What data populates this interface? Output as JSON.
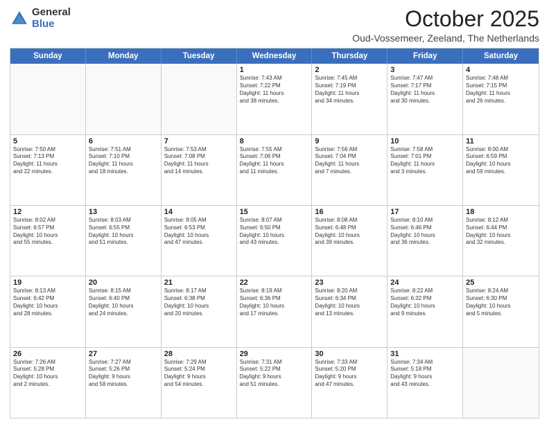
{
  "header": {
    "logo_general": "General",
    "logo_blue": "Blue",
    "month": "October 2025",
    "location": "Oud-Vossemeer, Zeeland, The Netherlands"
  },
  "days_of_week": [
    "Sunday",
    "Monday",
    "Tuesday",
    "Wednesday",
    "Thursday",
    "Friday",
    "Saturday"
  ],
  "weeks": [
    [
      {
        "day": "",
        "text": ""
      },
      {
        "day": "",
        "text": ""
      },
      {
        "day": "",
        "text": ""
      },
      {
        "day": "1",
        "text": "Sunrise: 7:43 AM\nSunset: 7:22 PM\nDaylight: 11 hours\nand 38 minutes."
      },
      {
        "day": "2",
        "text": "Sunrise: 7:45 AM\nSunset: 7:19 PM\nDaylight: 11 hours\nand 34 minutes."
      },
      {
        "day": "3",
        "text": "Sunrise: 7:47 AM\nSunset: 7:17 PM\nDaylight: 11 hours\nand 30 minutes."
      },
      {
        "day": "4",
        "text": "Sunrise: 7:48 AM\nSunset: 7:15 PM\nDaylight: 11 hours\nand 26 minutes."
      }
    ],
    [
      {
        "day": "5",
        "text": "Sunrise: 7:50 AM\nSunset: 7:13 PM\nDaylight: 11 hours\nand 22 minutes."
      },
      {
        "day": "6",
        "text": "Sunrise: 7:51 AM\nSunset: 7:10 PM\nDaylight: 11 hours\nand 18 minutes."
      },
      {
        "day": "7",
        "text": "Sunrise: 7:53 AM\nSunset: 7:08 PM\nDaylight: 11 hours\nand 14 minutes."
      },
      {
        "day": "8",
        "text": "Sunrise: 7:55 AM\nSunset: 7:06 PM\nDaylight: 11 hours\nand 11 minutes."
      },
      {
        "day": "9",
        "text": "Sunrise: 7:56 AM\nSunset: 7:04 PM\nDaylight: 11 hours\nand 7 minutes."
      },
      {
        "day": "10",
        "text": "Sunrise: 7:58 AM\nSunset: 7:01 PM\nDaylight: 11 hours\nand 3 minutes."
      },
      {
        "day": "11",
        "text": "Sunrise: 8:00 AM\nSunset: 6:59 PM\nDaylight: 10 hours\nand 59 minutes."
      }
    ],
    [
      {
        "day": "12",
        "text": "Sunrise: 8:02 AM\nSunset: 6:57 PM\nDaylight: 10 hours\nand 55 minutes."
      },
      {
        "day": "13",
        "text": "Sunrise: 8:03 AM\nSunset: 6:55 PM\nDaylight: 10 hours\nand 51 minutes."
      },
      {
        "day": "14",
        "text": "Sunrise: 8:05 AM\nSunset: 6:53 PM\nDaylight: 10 hours\nand 47 minutes."
      },
      {
        "day": "15",
        "text": "Sunrise: 8:07 AM\nSunset: 6:50 PM\nDaylight: 10 hours\nand 43 minutes."
      },
      {
        "day": "16",
        "text": "Sunrise: 8:08 AM\nSunset: 6:48 PM\nDaylight: 10 hours\nand 39 minutes."
      },
      {
        "day": "17",
        "text": "Sunrise: 8:10 AM\nSunset: 6:46 PM\nDaylight: 10 hours\nand 36 minutes."
      },
      {
        "day": "18",
        "text": "Sunrise: 8:12 AM\nSunset: 6:44 PM\nDaylight: 10 hours\nand 32 minutes."
      }
    ],
    [
      {
        "day": "19",
        "text": "Sunrise: 8:13 AM\nSunset: 6:42 PM\nDaylight: 10 hours\nand 28 minutes."
      },
      {
        "day": "20",
        "text": "Sunrise: 8:15 AM\nSunset: 6:40 PM\nDaylight: 10 hours\nand 24 minutes."
      },
      {
        "day": "21",
        "text": "Sunrise: 8:17 AM\nSunset: 6:38 PM\nDaylight: 10 hours\nand 20 minutes."
      },
      {
        "day": "22",
        "text": "Sunrise: 8:19 AM\nSunset: 6:36 PM\nDaylight: 10 hours\nand 17 minutes."
      },
      {
        "day": "23",
        "text": "Sunrise: 8:20 AM\nSunset: 6:34 PM\nDaylight: 10 hours\nand 13 minutes."
      },
      {
        "day": "24",
        "text": "Sunrise: 8:22 AM\nSunset: 6:32 PM\nDaylight: 10 hours\nand 9 minutes."
      },
      {
        "day": "25",
        "text": "Sunrise: 8:24 AM\nSunset: 6:30 PM\nDaylight: 10 hours\nand 5 minutes."
      }
    ],
    [
      {
        "day": "26",
        "text": "Sunrise: 7:26 AM\nSunset: 5:28 PM\nDaylight: 10 hours\nand 2 minutes."
      },
      {
        "day": "27",
        "text": "Sunrise: 7:27 AM\nSunset: 5:26 PM\nDaylight: 9 hours\nand 58 minutes."
      },
      {
        "day": "28",
        "text": "Sunrise: 7:29 AM\nSunset: 5:24 PM\nDaylight: 9 hours\nand 54 minutes."
      },
      {
        "day": "29",
        "text": "Sunrise: 7:31 AM\nSunset: 5:22 PM\nDaylight: 9 hours\nand 51 minutes."
      },
      {
        "day": "30",
        "text": "Sunrise: 7:33 AM\nSunset: 5:20 PM\nDaylight: 9 hours\nand 47 minutes."
      },
      {
        "day": "31",
        "text": "Sunrise: 7:34 AM\nSunset: 5:18 PM\nDaylight: 9 hours\nand 43 minutes."
      },
      {
        "day": "",
        "text": ""
      }
    ]
  ]
}
